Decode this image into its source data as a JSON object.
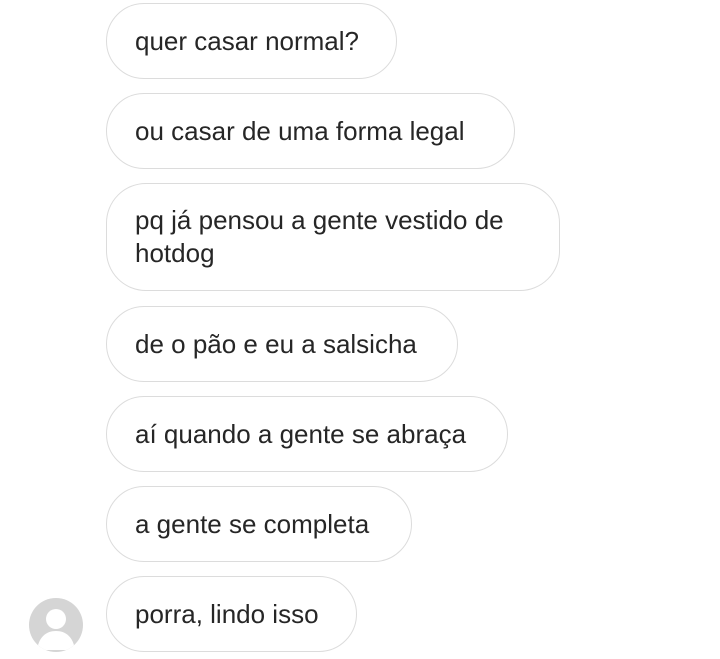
{
  "messages": [
    {
      "text": "quer casar normal?"
    },
    {
      "text": "ou casar de uma forma legal"
    },
    {
      "text": "pq já pensou a gente vestido de hotdog"
    },
    {
      "text": "de o pão e eu a salsicha"
    },
    {
      "text": "aí quando a gente se abraça"
    },
    {
      "text": "a gente se completa"
    },
    {
      "text": "porra, lindo isso"
    }
  ],
  "avatar_icon": "user-avatar-placeholder-icon"
}
